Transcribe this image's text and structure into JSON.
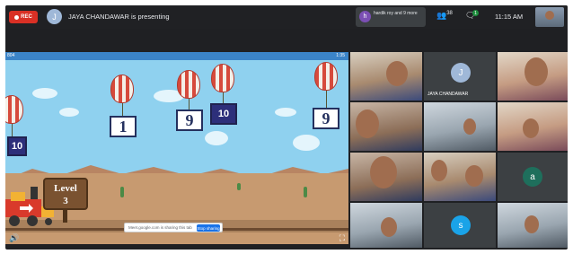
{
  "topbar": {
    "rec_label": "REC",
    "presenter_avatar_letter": "J",
    "presenting_text": "JAYA CHANDAWAR is presenting",
    "notification": {
      "avatar_letter": "h",
      "text": "hardik roy and 9 more"
    },
    "participant_count": "38",
    "chat_badge": "1",
    "clock": "11:15 AM"
  },
  "game": {
    "score": "804",
    "timer": "1:35",
    "level_title": "Level",
    "level_number": "3",
    "balloons": [
      {
        "value": "10",
        "style": "dark"
      },
      {
        "value": "1",
        "style": "light"
      },
      {
        "value": "9",
        "style": "light"
      },
      {
        "value": "10",
        "style": "dark"
      },
      {
        "value": "9",
        "style": "light"
      }
    ],
    "share_banner_text": "Meet.google.com is sharing this tab",
    "stop_sharing_label": "Stop sharing"
  },
  "participants": {
    "tile_jaya_letter": "J",
    "tile_jaya_name": "JAYA CHANDAWAR",
    "tile_a_letter": "a",
    "tile_s_letter": "s"
  },
  "colors": {
    "rec": "#d93025",
    "meet_bg": "#202124",
    "sky": "#8fd1ef",
    "ground": "#c79a70",
    "balloon_red": "#d64a3c",
    "avatar_green": "#1e6f5c",
    "avatar_blue": "#1aa3e8"
  }
}
